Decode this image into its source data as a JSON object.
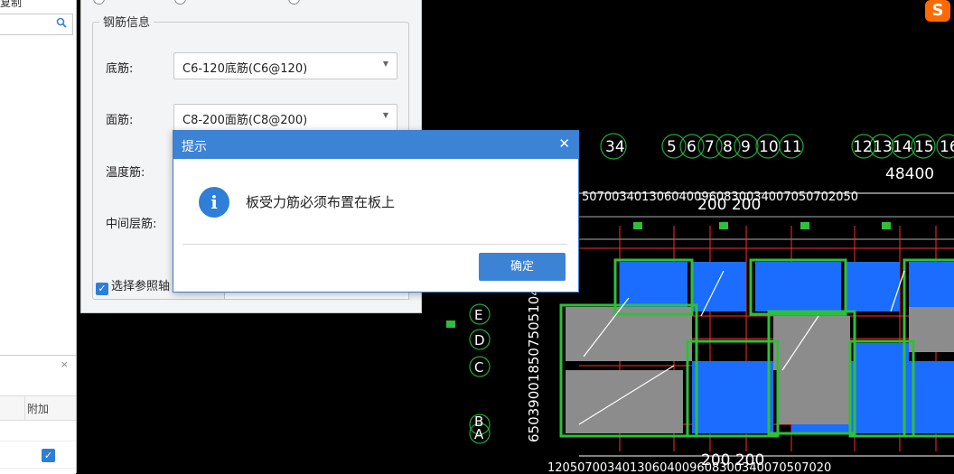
{
  "left_panel": {
    "title_fragment": "复制",
    "search_icon": "search-icon",
    "bottom_header": "附加",
    "close_glyph": "×"
  },
  "rebar_dialog": {
    "group_title": "钢筋信息",
    "fields": [
      {
        "label": "底筋:",
        "value": "C6-120底筋(C6@120)"
      },
      {
        "label": "面筋:",
        "value": "C8-200面筋(C8@200)"
      },
      {
        "label": "温度筋:",
        "value": ""
      },
      {
        "label": "中间层筋:",
        "value": ""
      }
    ],
    "checkbox_label": "选择参照轴"
  },
  "modal": {
    "title": "提示",
    "message": "板受力筋必须布置在板上",
    "ok_label": "确定",
    "icon": "info-icon"
  },
  "cad": {
    "top_axis_labels": [
      "34",
      "5",
      "6",
      "7",
      "8",
      "9",
      "10",
      "11",
      "12",
      "13",
      "14",
      "15",
      "16"
    ],
    "top_dimension": "48400",
    "mid_dimension": "200 200",
    "left_axis_labels": [
      "E",
      "D",
      "C",
      "B",
      "A"
    ],
    "bottom_dimension": "200 200",
    "accent_colors": {
      "slab": "#1a6dff",
      "wall": "#2fbf3a",
      "rebar": "#ff2b2b",
      "grid": "#ffffff"
    }
  },
  "sogou_icon": "sogou-ime-icon"
}
